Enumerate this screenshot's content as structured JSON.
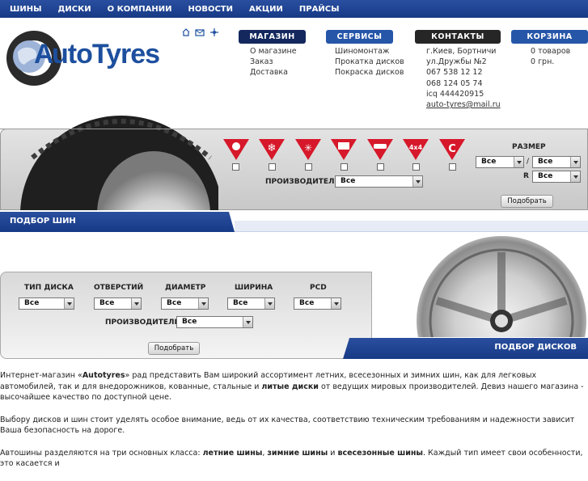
{
  "topnav": [
    "ШИНЫ",
    "ДИСКИ",
    "О КОМПАНИИ",
    "НОВОСТИ",
    "АКЦИИ",
    "ПРАЙСЫ"
  ],
  "logo": {
    "text": "utoTyres",
    "letter": "A"
  },
  "header_icons": [
    "home-icon",
    "mail-icon",
    "sitemap-icon"
  ],
  "menus": {
    "shop": {
      "title": "МАГАЗИН",
      "color": "#14285e",
      "items": [
        "О магазине",
        "Заказ",
        "Доставка"
      ]
    },
    "services": {
      "title": "СЕРВИСЫ",
      "color": "#2656a8",
      "items": [
        "Шиномонтаж",
        "Прокатка дисков",
        "Покраска дисков"
      ]
    },
    "contacts": {
      "title": "КОНТАКТЫ",
      "color": "#262626",
      "items": [
        "г.Киев, Бортничи",
        "ул.Дружбы №2",
        "067 538 12 12",
        "068 124 05 74",
        "icq 444420915"
      ],
      "email": "auto-tyres@mail.ru"
    },
    "cart": {
      "title": "КОРЗИНА",
      "color": "#2656a8",
      "items": [
        "0 товаров",
        "0 грн."
      ]
    }
  },
  "tyre_filter": {
    "seasons": [
      "sun-icon",
      "snowflake-icon",
      "all-season-icon",
      "truck-icon",
      "car-icon",
      "4x4-icon",
      "commercial-icon"
    ],
    "season_4x4_label": "4x4",
    "season_c_label": "C",
    "size_label": "РАЗМЕР",
    "separator": "/",
    "r_label": "R",
    "manufacturer_label": "ПРОИЗВОДИТЕЛЬ",
    "all": "Все",
    "submit": "Подобрать",
    "section_title": "ПОДБОР ШИН"
  },
  "disk_filter": {
    "labels": [
      "ТИП ДИСКА",
      "ОТВЕРСТИЙ",
      "ДИАМЕТР",
      "ШИРИНА",
      "PCD"
    ],
    "manufacturer_label": "ПРОИЗВОДИТЕЛЬ",
    "all": "Все",
    "submit": "Подобрать",
    "section_title": "ПОДБОР ДИСКОВ"
  },
  "content": {
    "p1_a": "Интернет-магазин «",
    "p1_brand": "Autotyres",
    "p1_b": "» рад представить Вам широкий ассортимент летних, всесезонных и зимних шин, как для легковых автомобилей, так и для внедорожников, кованные, стальные и ",
    "p1_bold": "литые диски",
    "p1_c": " от ведущих мировых производителей. Девиз нашего магазина - высочайшее качество по доступной цене.",
    "p2": "Выбору дисков и шин стоит уделять особое внимание, ведь от их качества, соответствию техническим требованиям и надежности зависит Ваша безопасность на дороге.",
    "p3_a": "Автошины разделяются на три основных класса: ",
    "p3_b1": "летние шины",
    "p3_s1": ", ",
    "p3_b2": "зимние шины",
    "p3_s2": " и ",
    "p3_b3": "всесезонные шины",
    "p3_c": ". Каждый тип имеет свои особенности, это касается и"
  }
}
